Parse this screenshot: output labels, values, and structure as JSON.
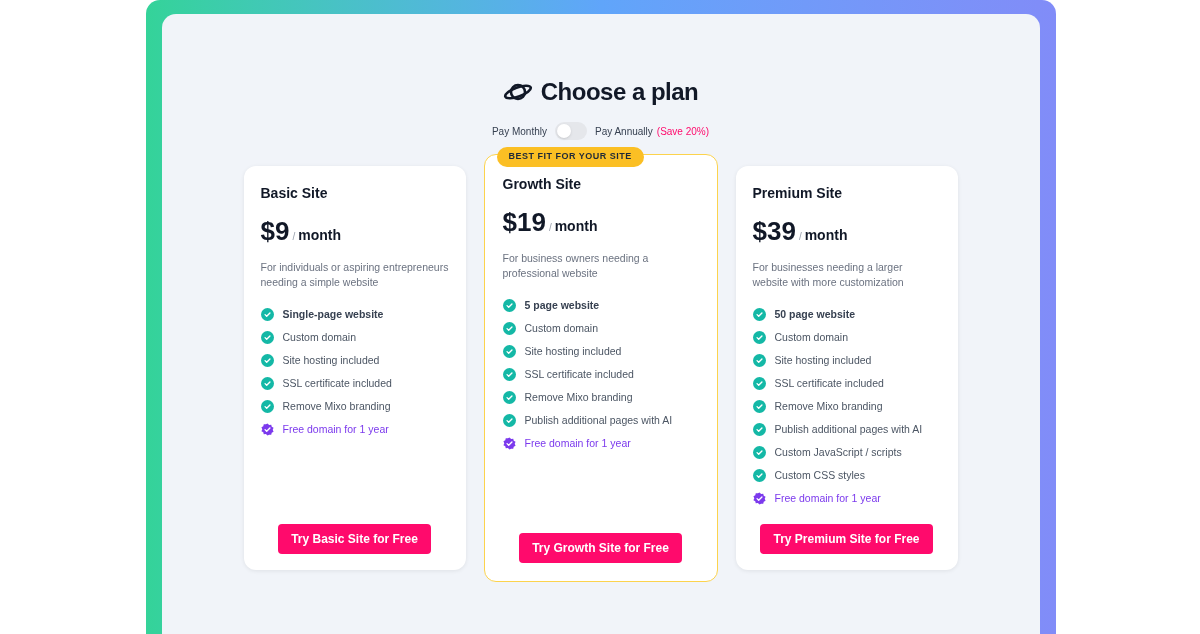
{
  "title": "Choose a plan",
  "billing": {
    "monthly_label": "Pay Monthly",
    "annual_label": "Pay Annually",
    "annual_note": "(Save 20%)",
    "on": false
  },
  "plans": [
    {
      "name": "Basic Site",
      "price": "$9",
      "period": "/",
      "unit": "month",
      "description": "For individuals or aspiring entrepreneurs needing a simple website",
      "featured": false,
      "cta": "Try Basic Site for Free",
      "features": [
        {
          "kind": "highlight",
          "text": "Single-page website"
        },
        {
          "kind": "check",
          "text": "Custom domain"
        },
        {
          "kind": "check",
          "text": "Site hosting included"
        },
        {
          "kind": "check",
          "text": "SSL certificate included"
        },
        {
          "kind": "check",
          "text": "Remove Mixo branding"
        },
        {
          "kind": "bonus",
          "text": "Free domain for 1 year"
        }
      ]
    },
    {
      "name": "Growth Site",
      "price": "$19",
      "period": "/",
      "unit": "month",
      "description": "For business owners needing a professional website",
      "featured": true,
      "badge": "BEST FIT FOR YOUR SITE",
      "cta": "Try Growth Site for Free",
      "features": [
        {
          "kind": "highlight",
          "text": "5 page website"
        },
        {
          "kind": "check",
          "text": "Custom domain"
        },
        {
          "kind": "check",
          "text": "Site hosting included"
        },
        {
          "kind": "check",
          "text": "SSL certificate included"
        },
        {
          "kind": "check",
          "text": "Remove Mixo branding"
        },
        {
          "kind": "check",
          "text": "Publish additional pages with AI"
        },
        {
          "kind": "bonus",
          "text": "Free domain for 1 year"
        }
      ]
    },
    {
      "name": "Premium Site",
      "price": "$39",
      "period": "/",
      "unit": "month",
      "description": "For businesses needing a larger website with more customization",
      "featured": false,
      "cta": "Try Premium Site for Free",
      "features": [
        {
          "kind": "highlight",
          "text": "50 page website"
        },
        {
          "kind": "check",
          "text": "Custom domain"
        },
        {
          "kind": "check",
          "text": "Site hosting included"
        },
        {
          "kind": "check",
          "text": "SSL certificate included"
        },
        {
          "kind": "check",
          "text": "Remove Mixo branding"
        },
        {
          "kind": "check",
          "text": "Publish additional pages with AI"
        },
        {
          "kind": "check",
          "text": "Custom JavaScript / scripts"
        },
        {
          "kind": "check",
          "text": "Custom CSS styles"
        },
        {
          "kind": "bonus",
          "text": "Free domain for 1 year"
        }
      ]
    }
  ]
}
